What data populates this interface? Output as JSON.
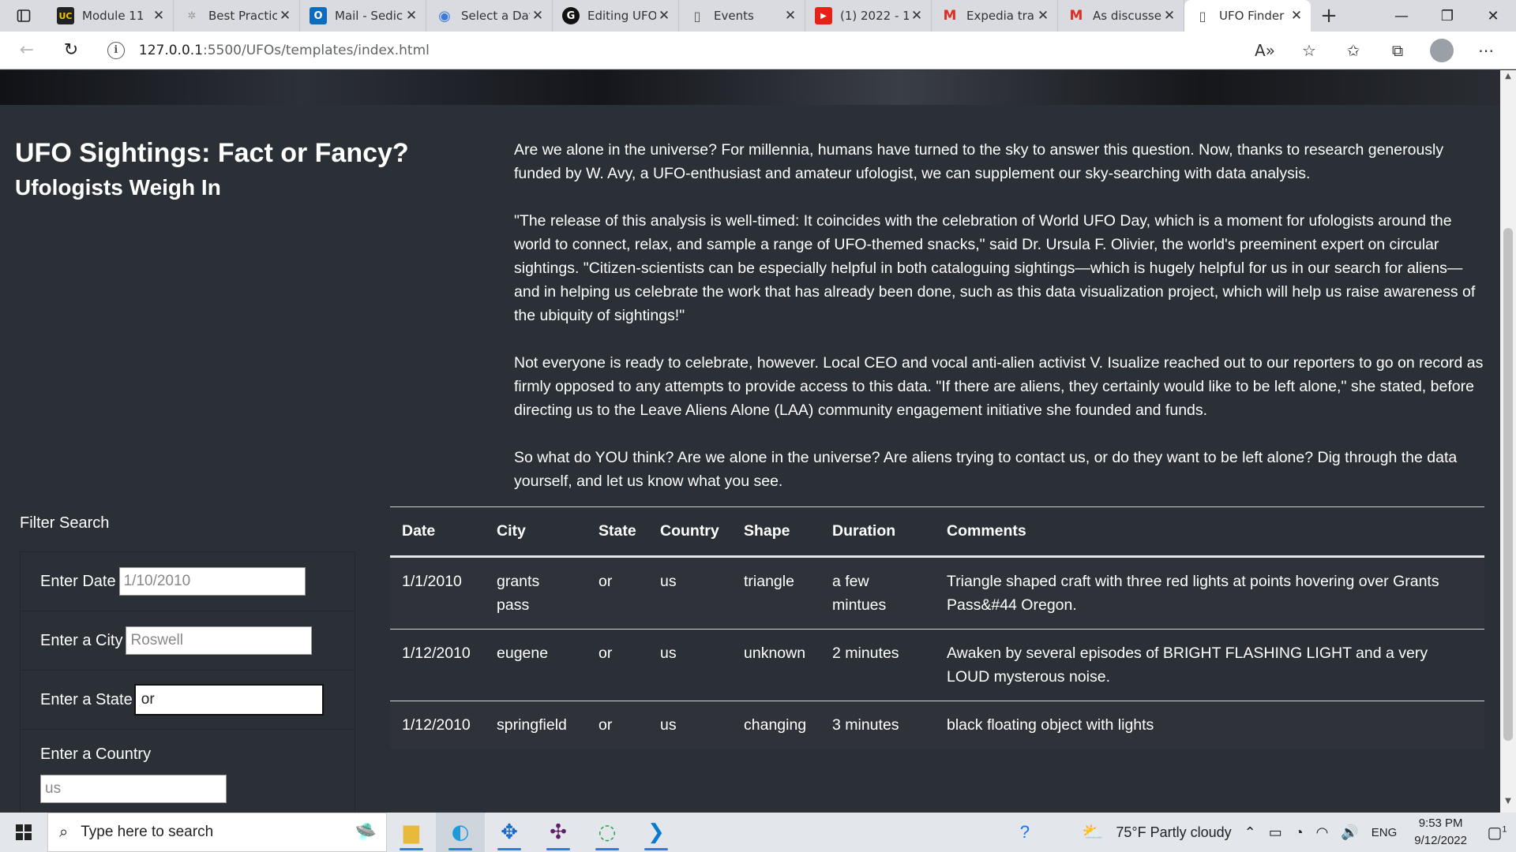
{
  "browser": {
    "tabs": [
      {
        "label": "Module 11",
        "favicon": "uc-icon",
        "active": false
      },
      {
        "label": "Best Practic",
        "favicon": "gear-icon",
        "active": false
      },
      {
        "label": "Mail - Sedic",
        "favicon": "outlook-icon",
        "active": false
      },
      {
        "label": "Select a Dat",
        "favicon": "globe-icon",
        "active": false
      },
      {
        "label": "Editing UFO",
        "favicon": "github-icon",
        "active": false
      },
      {
        "label": "Events",
        "favicon": "page-icon",
        "active": false
      },
      {
        "label": "(1) 2022 - 1",
        "favicon": "youtube-icon",
        "active": false
      },
      {
        "label": "Expedia tra",
        "favicon": "gmail-icon",
        "active": false
      },
      {
        "label": "As discusse",
        "favicon": "gmail-icon",
        "active": false
      },
      {
        "label": "UFO Finder",
        "favicon": "page-icon",
        "active": true
      }
    ],
    "url_host": "127.0.0.1",
    "url_path": ":5500/UFOs/templates/index.html"
  },
  "page": {
    "title": "UFO Sightings: Fact or Fancy?",
    "subtitle": "Ufologists Weigh In",
    "article": [
      "Are we alone in the universe? For millennia, humans have turned to the sky to answer this question. Now, thanks to research generously funded by W. Avy, a UFO-enthusiast and amateur ufologist, we can supplement our sky-searching with data analysis.",
      "\"The release of this analysis is well-timed: It coincides with the celebration of World UFO Day, which is a moment for ufologists around the world to connect, relax, and sample a range of UFO-themed snacks,\" said Dr. Ursula F. Olivier, the world's preeminent expert on circular sightings. \"Citizen-scientists can be especially helpful in both cataloguing sightings—which is hugely helpful for us in our search for aliens—and in helping us celebrate the work that has already been done, such as this data visualization project, which will help us raise awareness of the ubiquity of sightings!\"",
      "Not everyone is ready to celebrate, however. Local CEO and vocal anti-alien activist V. Isualize reached out to our reporters to go on record as firmly opposed to any attempts to provide access to this data. \"If there are aliens, they certainly would like to be left alone,\" she stated, before directing us to the Leave Aliens Alone (LAA) community engagement initiative she founded and funds.",
      "So what do YOU think? Are we alone in the universe? Are aliens trying to contact us, or do they want to be left alone? Dig through the data yourself, and let us know what you see."
    ],
    "filter": {
      "heading": "Filter Search",
      "date_label": "Enter Date",
      "date_placeholder": "1/10/2010",
      "city_label": "Enter a City",
      "city_placeholder": "Roswell",
      "state_label": "Enter a State",
      "state_value": "or",
      "country_label": "Enter a Country",
      "country_placeholder": "us"
    },
    "table": {
      "headers": [
        "Date",
        "City",
        "State",
        "Country",
        "Shape",
        "Duration",
        "Comments"
      ],
      "rows": [
        [
          "1/1/2010",
          "grants pass",
          "or",
          "us",
          "triangle",
          "a few mintues",
          "Triangle shaped craft with three red lights at points hovering over Grants Pass&#44 Oregon."
        ],
        [
          "1/12/2010",
          "eugene",
          "or",
          "us",
          "unknown",
          "2 minutes",
          "Awaken by several episodes of BRIGHT FLASHING LIGHT and a very LOUD mysterous noise."
        ],
        [
          "1/12/2010",
          "springfield",
          "or",
          "us",
          "changing",
          "3 minutes",
          "black floating object with lights"
        ]
      ]
    }
  },
  "taskbar": {
    "search_placeholder": "Type here to search",
    "weather": "75°F  Partly cloudy",
    "language": "ENG",
    "time": "9:53 PM",
    "date": "9/12/2022",
    "notification_count": "1"
  }
}
